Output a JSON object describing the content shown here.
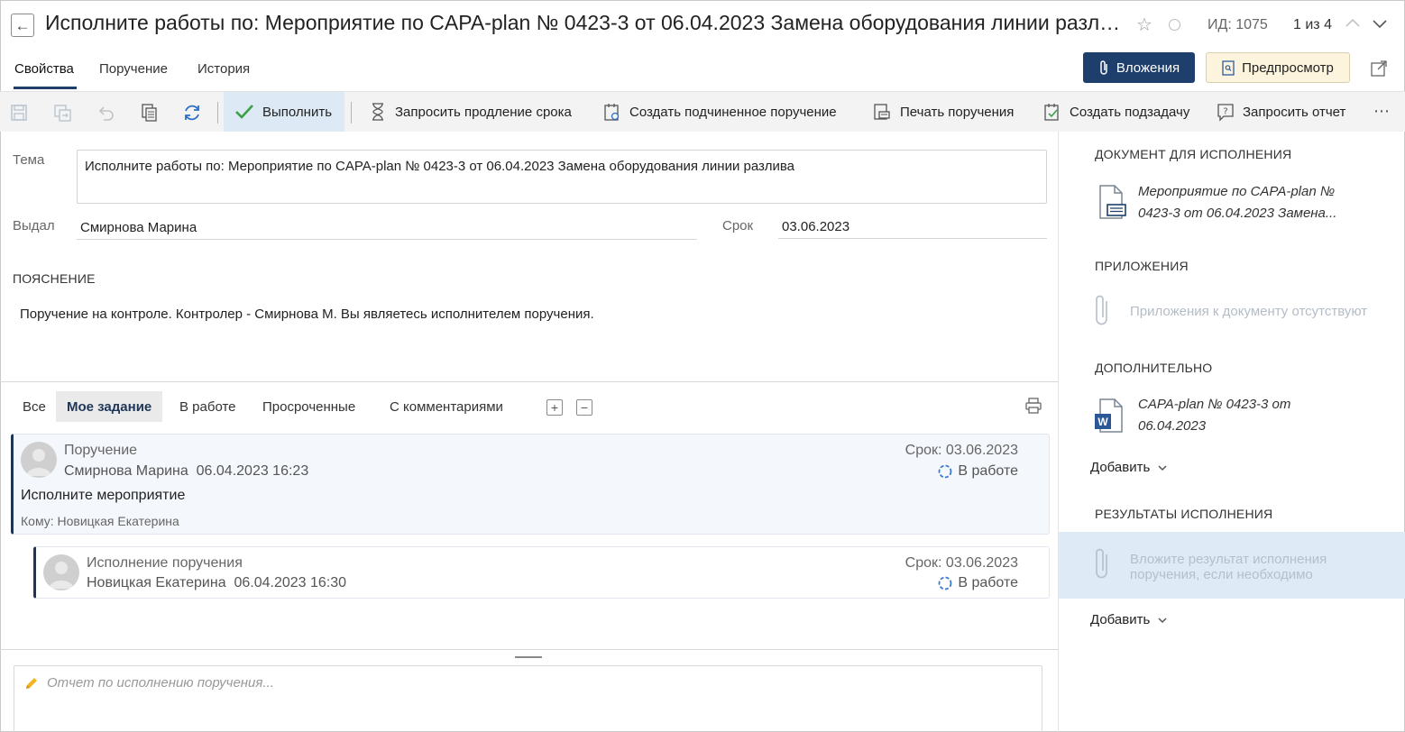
{
  "header": {
    "title": "Исполните работы по: Мероприятие по CAPA-plan № 0423-3 от 06.04.2023 Замена оборудования линии разлива",
    "doc_id": "ИД: 1075",
    "pager": "1 из 4"
  },
  "tabs": [
    {
      "label": "Свойства",
      "active": true
    },
    {
      "label": "Поручение"
    },
    {
      "label": "История"
    }
  ],
  "header_buttons": {
    "attachments": "Вложения",
    "preview": "Предпросмотр"
  },
  "toolbar": {
    "execute": "Выполнить",
    "request_extension": "Запросить продление срока",
    "create_subordinate": "Создать подчиненное поручение",
    "print": "Печать поручения",
    "create_subtask": "Создать подзадачу",
    "request_report": "Запросить отчет"
  },
  "form": {
    "topic_label": "Тема",
    "topic_value": "Исполните работы по: Мероприятие по CAPA-plan № 0423-3  от 06.04.2023 Замена оборудования линии разлива",
    "issued_label": "Выдал",
    "issued_value": "Смирнова Марина",
    "due_label": "Срок",
    "due_value": "03.06.2023",
    "note_header": "ПОЯСНЕНИЕ",
    "note_text": "Поручение на контроле. Контролер - Смирнова М. Вы являетесь исполнителем поручения."
  },
  "filters": [
    {
      "label": "Все"
    },
    {
      "label": "Мое задание",
      "active": true
    },
    {
      "label": "В работе"
    },
    {
      "label": "Просроченные"
    },
    {
      "label": "С комментариями"
    }
  ],
  "tasks": [
    {
      "title": "Поручение",
      "author": "Смирнова Марина",
      "datetime": "06.04.2023 16:23",
      "due": "Срок: 03.06.2023",
      "status": "В работе",
      "body": "Исполните мероприятие",
      "to": "Кому: Новицкая Екатерина"
    },
    {
      "title": "Исполнение поручения",
      "author": "Новицкая Екатерина",
      "datetime": "06.04.2023 16:30",
      "due": "Срок: 03.06.2023",
      "status": "В работе"
    }
  ],
  "report_placeholder": "Отчет по исполнению поручения...",
  "right_panel": {
    "doc_header": "ДОКУМЕНТ ДЛЯ ИСПОЛНЕНИЯ",
    "doc_line1": "Мероприятие по CAPA-plan №",
    "doc_line2": "0423-3 от 06.04.2023 Замена...",
    "attachments_header": "ПРИЛОЖЕНИЯ",
    "attachments_empty": "Приложения к документу отсутствуют",
    "additional_header": "ДОПОЛНИТЕЛЬНО",
    "additional_line1": "CAPA-plan № 0423-3 от",
    "additional_line2": "06.04.2023",
    "add_label": "Добавить",
    "results_header": "РЕЗУЛЬТАТЫ ИСПОЛНЕНИЯ",
    "results_line1": "Вложите результат исполнения",
    "results_line2": "поручения, если необходимо",
    "add_label_2": "Добавить"
  },
  "colors": {
    "accent": "#1e3f6b",
    "preview_bg": "#fcf4dc",
    "toolbar_bg": "#f3f3f3",
    "dropzone": "#deebf7",
    "status_icon": "#3a7bd5"
  }
}
